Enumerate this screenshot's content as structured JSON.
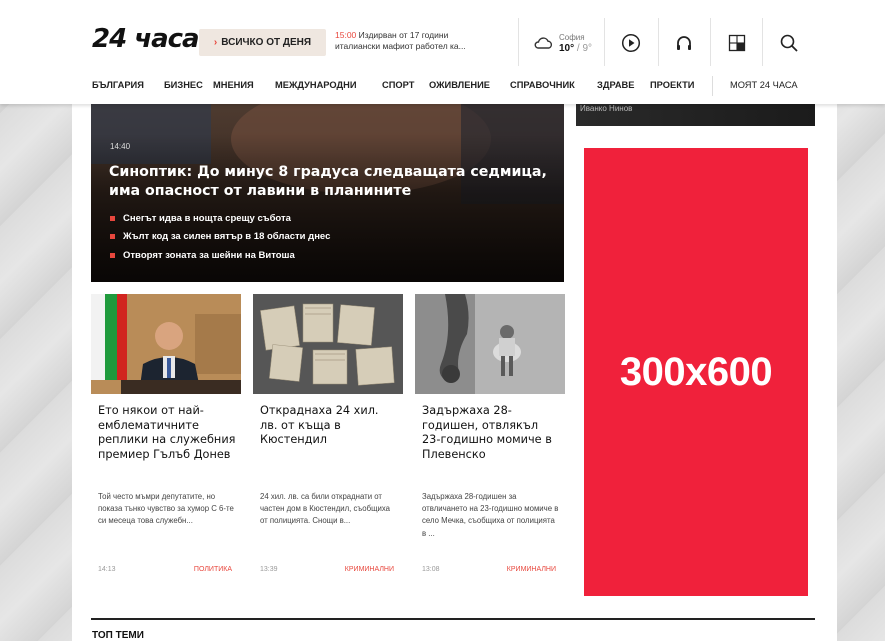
{
  "header": {
    "logo": "24 часа",
    "all_day_label": "ВСИЧКО ОТ ДЕНЯ",
    "ticker": {
      "time": "15:00",
      "text_line1": "Издирван от 17 години",
      "text_line2": "италиански мафиот работел ка..."
    },
    "weather": {
      "city": "София",
      "temp_high": "10°",
      "temp_sep": " / ",
      "temp_low": "9°"
    },
    "icons": [
      "play-icon",
      "headphones-icon",
      "crossword-icon",
      "search-icon"
    ]
  },
  "nav": {
    "items": [
      "БЪЛГАРИЯ",
      "БИЗНЕС",
      "МНЕНИЯ",
      "МЕЖДУНАРОДНИ",
      "СПОРТ",
      "ОЖИВЛЕНИЕ",
      "СПРАВОЧНИК",
      "ЗДРАВЕ",
      "ПРОЕКТИ"
    ],
    "my_label": "МОЯТ 24 ЧАСА"
  },
  "hero": {
    "time": "14:40",
    "title": "Синоптик: До минус 8 градуса следващата седмица, има опасност от лавини в планините",
    "bullets": [
      "Снегът идва в нощта срещу събота",
      "Жълт код за силен вятър в 18 области днес",
      "Отвoрят зоната за шейни на Витоша"
    ]
  },
  "right_strip": {
    "text": "Иванко Нинов"
  },
  "ad": {
    "label": "300x600"
  },
  "cards": [
    {
      "headline": "Ето някои от най-емблематичните реплики на служебния премиер Гълъб Донев",
      "lead": "Той често мъмри депутатите, но показа тънко чувство за хумор С 6-те си месеца това служебн...",
      "time": "14:13",
      "category": "ПОЛИТИКА"
    },
    {
      "headline": "Откраднаха 24 хил. лв. от къща в Кюстендил",
      "lead": "24 хил. лв. са били откраднати от частен дом в Кюстендил, съобщиха от полицията. Снощи в...",
      "time": "13:39",
      "category": "КРИМИНАЛНИ"
    },
    {
      "headline": "Задържаха 28-годишен, отвлякъл 23-годишно момиче в Плевенско",
      "lead": "Задържаха 28-годишен за отвличането на 23-годишно момиче в село Мечка, съобщиха от полицията в ...",
      "time": "13:08",
      "category": "КРИМИНАЛНИ"
    }
  ],
  "sections": {
    "top_topics": "ТОП ТЕМИ"
  },
  "colors": {
    "accent": "#e8473d",
    "ad_bg": "#f0213b"
  }
}
